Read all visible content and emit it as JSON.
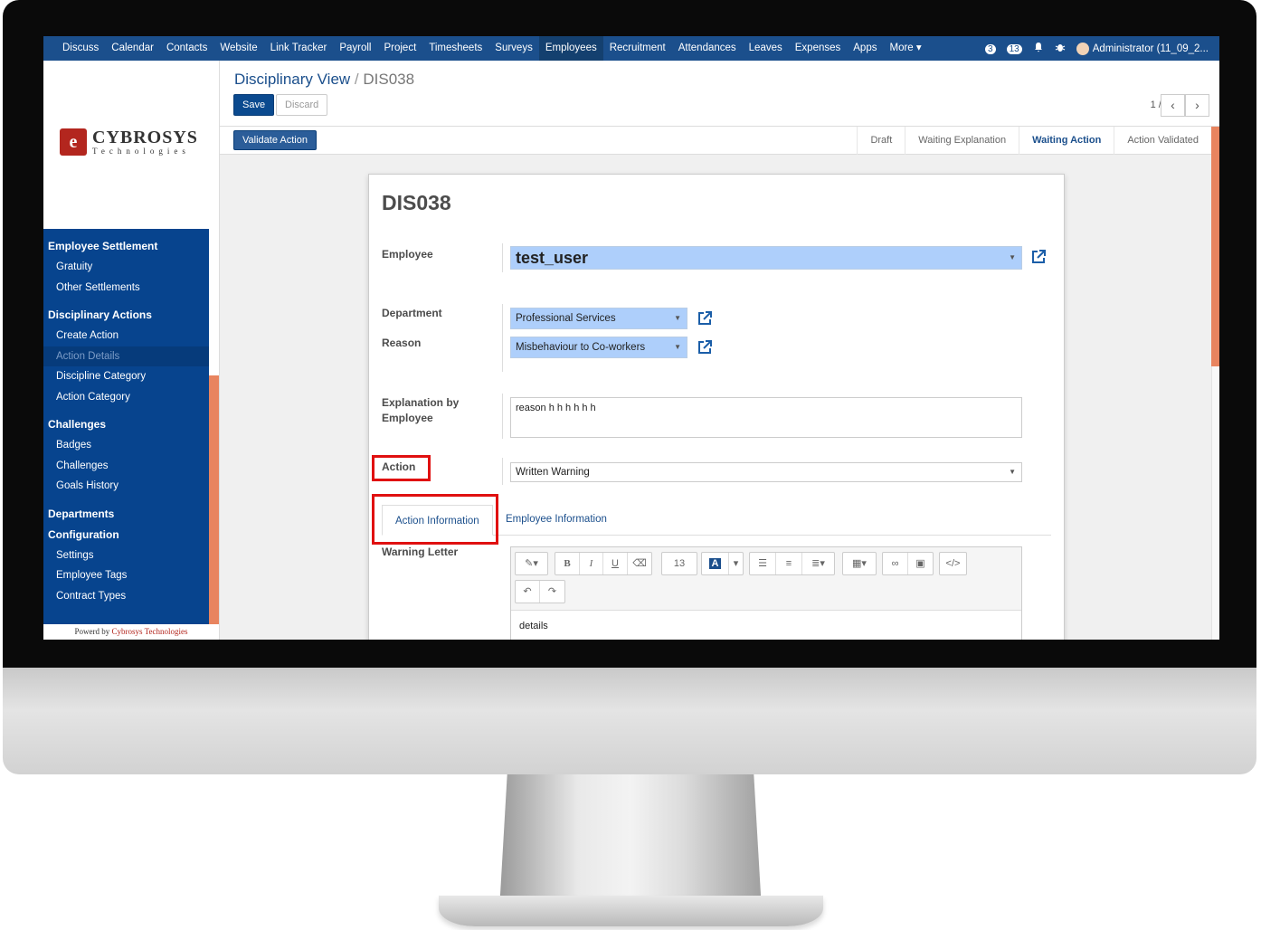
{
  "topnav": {
    "items": [
      "Discuss",
      "Calendar",
      "Contacts",
      "Website",
      "Link Tracker",
      "Payroll",
      "Project",
      "Timesheets",
      "Surveys",
      "Employees",
      "Recruitment",
      "Attendances",
      "Leaves",
      "Expenses",
      "Apps",
      "More ▾"
    ],
    "active": "Employees",
    "conversations_count": "3",
    "activities_count": "13",
    "user": "Administrator (11_09_2..."
  },
  "logo": {
    "name": "CYBROSYS",
    "tagline": "Technologies",
    "mark": "e"
  },
  "sidebar": {
    "sections": [
      {
        "title": "Employee Settlement",
        "items": [
          "Gratuity",
          "Other Settlements"
        ]
      },
      {
        "title": "Disciplinary Actions",
        "items": [
          "Create Action",
          "Action Details",
          "Discipline Category",
          "Action Category"
        ]
      },
      {
        "title": "Challenges",
        "items": [
          "Badges",
          "Challenges",
          "Goals History"
        ]
      },
      {
        "title": "Departments",
        "items": []
      },
      {
        "title": "Configuration",
        "items": [
          "Settings",
          "Employee Tags",
          "Contract Types"
        ]
      }
    ],
    "active_item": "Action Details",
    "powered_prefix": "Powerd by",
    "powered_brand": "Cybrosys Technologies"
  },
  "control_panel": {
    "breadcrumb_parent": "Disciplinary View",
    "breadcrumb_sep": "/",
    "breadcrumb_current": "DIS038",
    "save_label": "Save",
    "discard_label": "Discard",
    "pager": "1 / 1",
    "prev": "‹",
    "next": "›"
  },
  "statusbar": {
    "validate_label": "Validate Action",
    "stages": [
      "Draft",
      "Waiting Explanation",
      "Waiting Action",
      "Action Validated"
    ],
    "active_stage": "Waiting Action"
  },
  "form": {
    "title": "DIS038",
    "employee_label": "Employee",
    "employee_value": "test_user",
    "department_label": "Department",
    "department_value": "Professional Services",
    "reason_label": "Reason",
    "reason_value": "Misbehaviour to Co-workers",
    "explanation_label_1": "Explanation by",
    "explanation_label_2": "Employee",
    "explanation_value": "reason h h h h h  h",
    "action_label": "Action",
    "action_value": "Written Warning",
    "tabs": [
      "Action Information",
      "Employee Information"
    ],
    "active_tab": "Action Information",
    "warning_letter_label": "Warning Letter",
    "editor_font_size": "13",
    "editor_content": "details"
  },
  "colors": {
    "navbar": "#1b4f8c",
    "sidebar": "#07448e",
    "accent": "#e8845f",
    "highlight_box": "#e01010",
    "field_fill": "#aecffb"
  }
}
